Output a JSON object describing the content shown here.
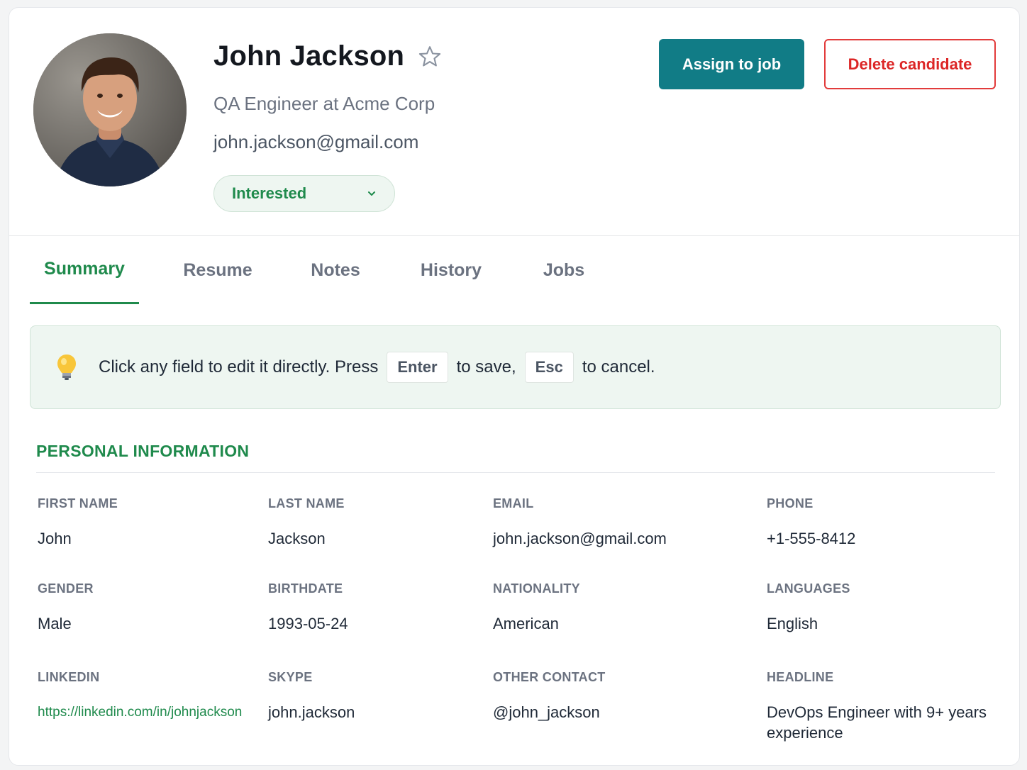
{
  "candidate": {
    "name": "John Jackson",
    "subtitle": "QA Engineer at Acme Corp",
    "email": "john.jackson@gmail.com",
    "status": "Interested"
  },
  "actions": {
    "assign_label": "Assign to job",
    "delete_label": "Delete candidate"
  },
  "tabs": [
    {
      "label": "Summary",
      "active": true
    },
    {
      "label": "Resume",
      "active": false
    },
    {
      "label": "Notes",
      "active": false
    },
    {
      "label": "History",
      "active": false
    },
    {
      "label": "Jobs",
      "active": false
    }
  ],
  "hint": {
    "icon": "lightbulb-icon",
    "text_before": "Click any field to edit it directly. Press",
    "key_save": "Enter",
    "text_middle": "to save,",
    "key_cancel": "Esc",
    "text_after": "to cancel."
  },
  "personal_info": {
    "title": "PERSONAL INFORMATION",
    "fields": [
      {
        "label": "FIRST NAME",
        "value": "John"
      },
      {
        "label": "LAST NAME",
        "value": "Jackson"
      },
      {
        "label": "EMAIL",
        "value": "john.jackson@gmail.com"
      },
      {
        "label": "PHONE",
        "value": "+1-555-8412"
      },
      {
        "label": "GENDER",
        "value": "Male"
      },
      {
        "label": "BIRTHDATE",
        "value": "1993-05-24"
      },
      {
        "label": "NATIONALITY",
        "value": "American"
      },
      {
        "label": "LANGUAGES",
        "value": "English"
      },
      {
        "label": "LINKEDIN",
        "value": "https://linkedin.com/in/johnjackson"
      },
      {
        "label": "SKYPE",
        "value": "john.jackson"
      },
      {
        "label": "OTHER CONTACT",
        "value": "@john_jackson"
      },
      {
        "label": "HEADLINE",
        "value": "DevOps Engineer with 9+ years experience"
      }
    ]
  },
  "colors": {
    "accent_green": "#1f8a4c",
    "primary_teal": "#117c86",
    "danger_red": "#dc2626"
  }
}
